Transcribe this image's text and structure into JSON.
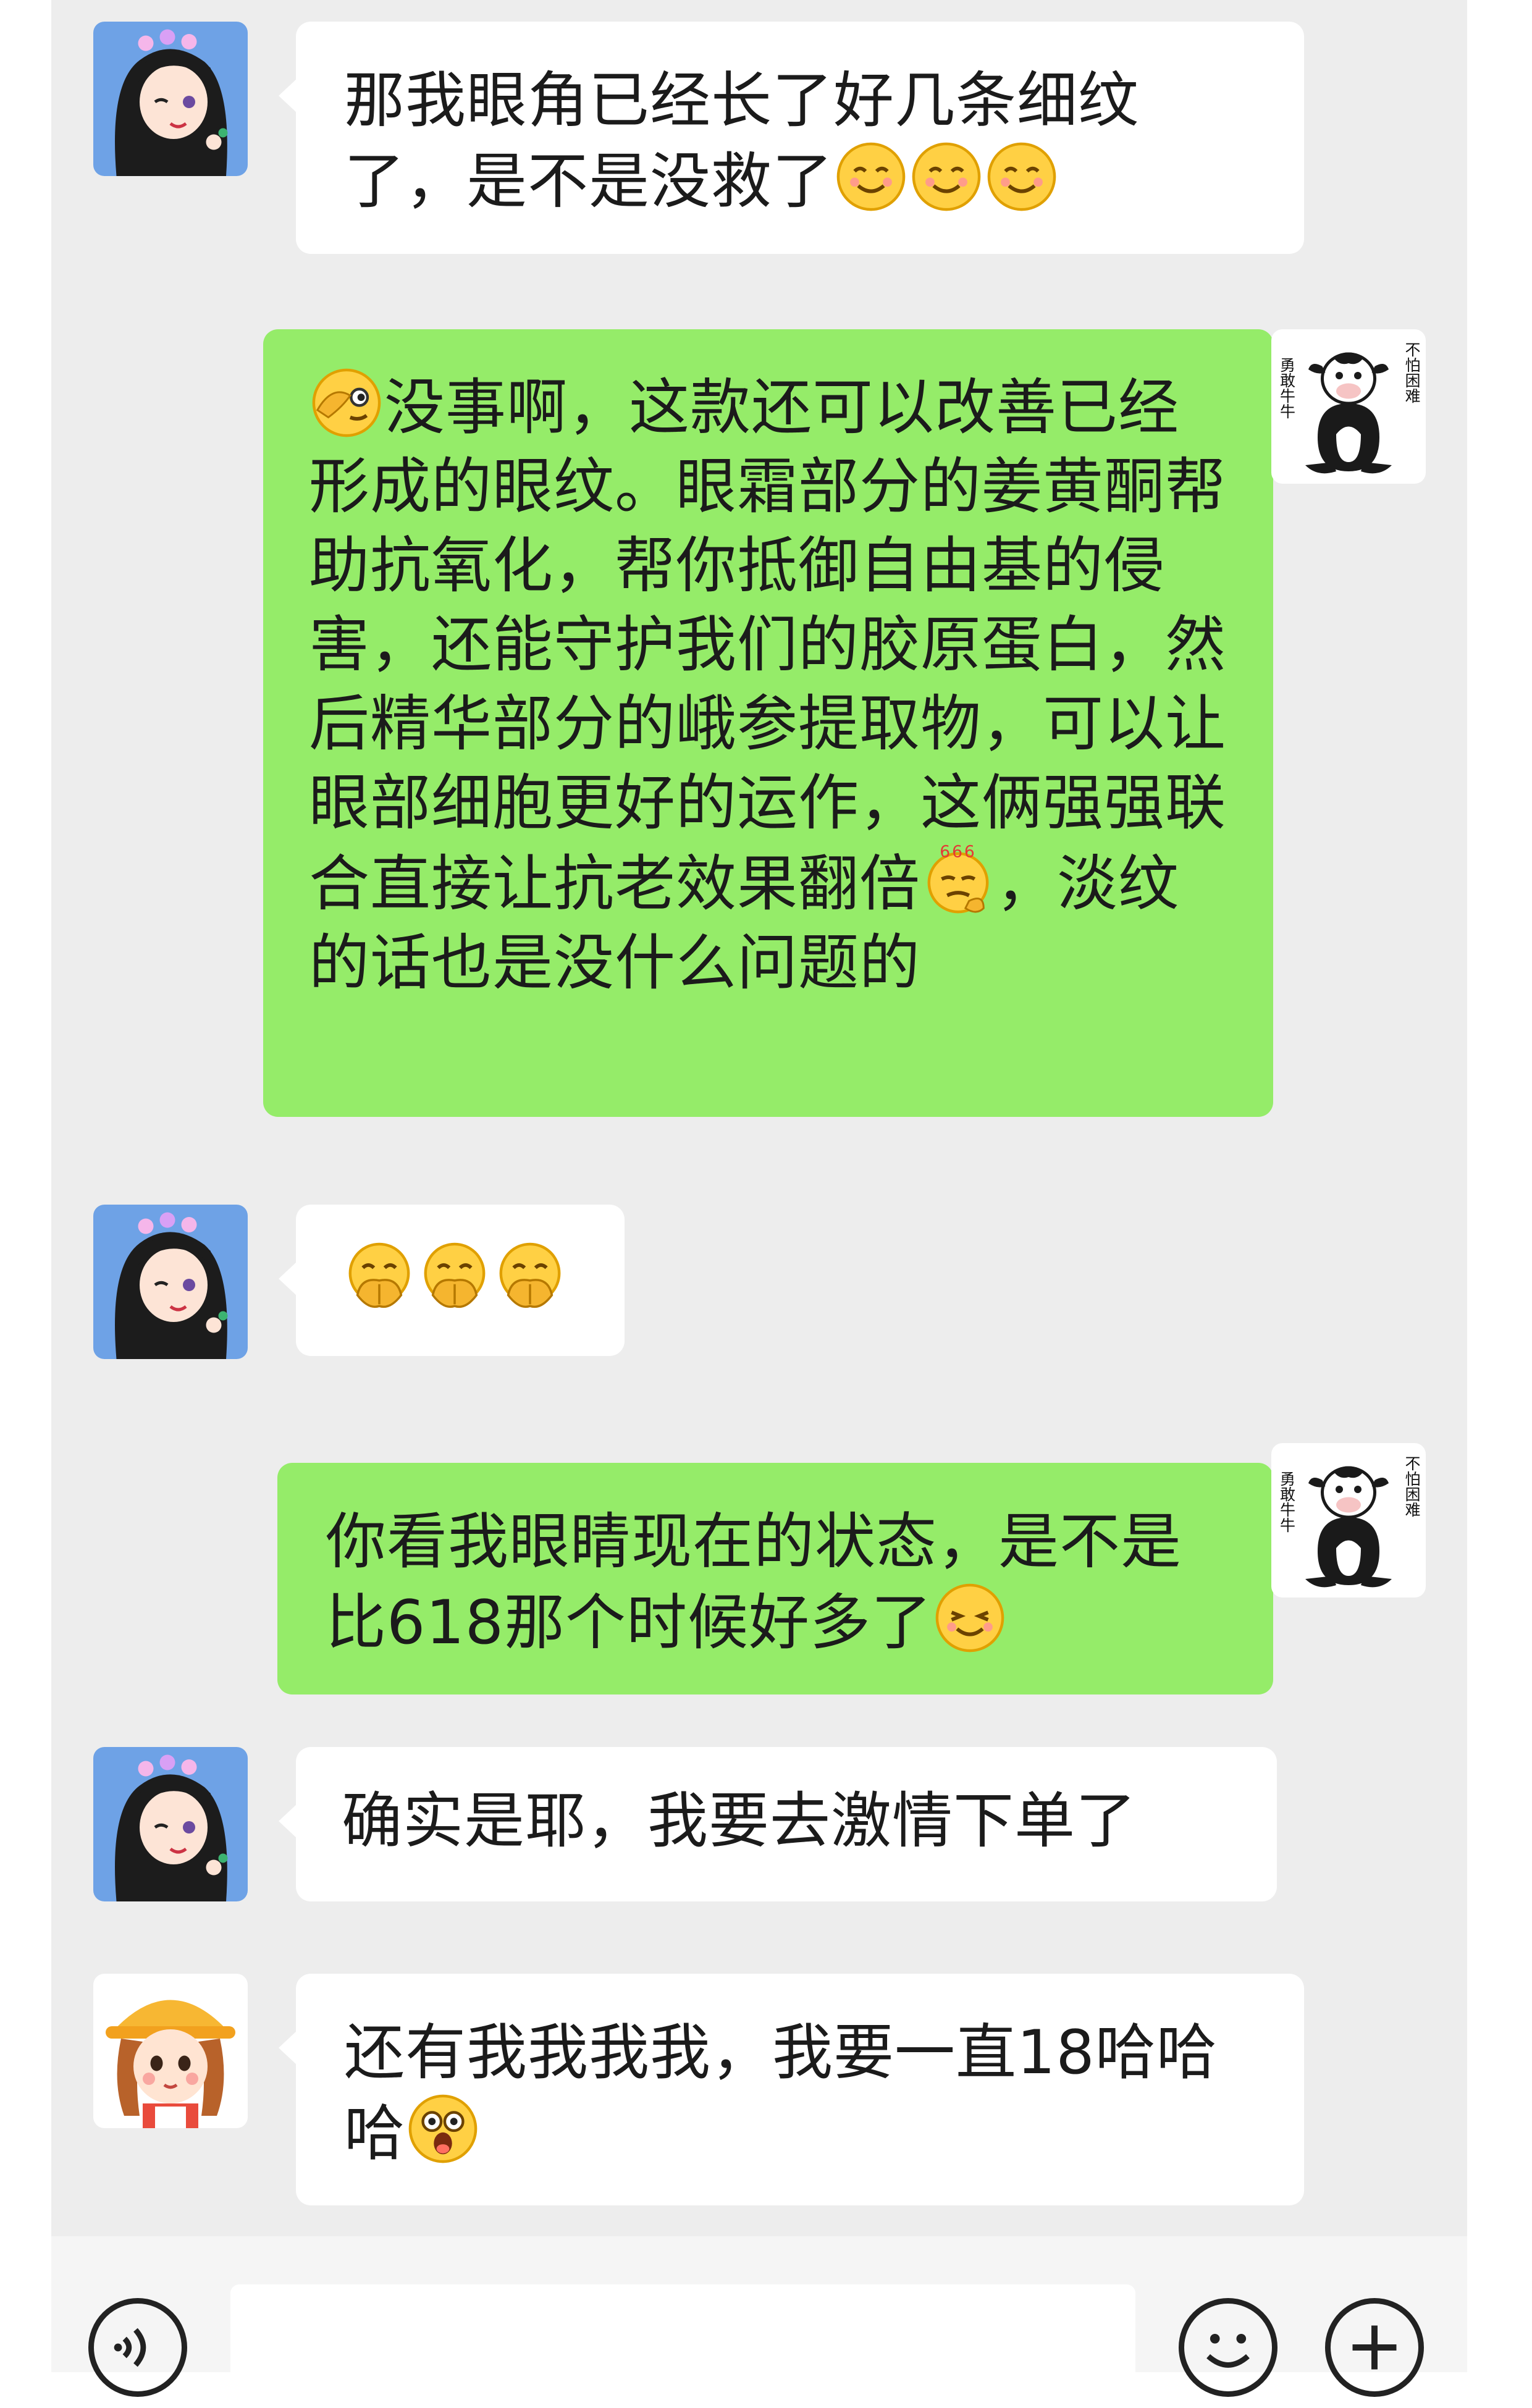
{
  "messages": [
    {
      "direction": "in",
      "sender": "girl",
      "text": "那我眼角已经长了好几条细纹了，是不是没救了",
      "emojis": [
        "smile-emoji",
        "smile-emoji",
        "smile-emoji"
      ]
    },
    {
      "direction": "out",
      "sender": "cow",
      "lead_emoji": "peek-emoji",
      "text_a": "没事啊，这款还可以改善已经形成的眼纹。眼霜部分的姜黄酮帮助抗氧化，帮你抵御自由基的侵害，还能守护我们的胶原蛋白，然后精华部分的峨参提取物，可以让眼部细胞更好的运作，这俩强强联合直接让抗老效果翻倍",
      "mid_emoji": "666-emoji",
      "text_b": "，淡纹的话也是没什么问题的"
    },
    {
      "direction": "in",
      "sender": "girl",
      "text": "",
      "emojis": [
        "fist-emoji",
        "fist-emoji",
        "fist-emoji"
      ]
    },
    {
      "direction": "out",
      "sender": "cow",
      "text": "你看我眼睛现在的状态，是不是比618那个时候好多了",
      "emojis": [
        "happy-emoji"
      ]
    },
    {
      "direction": "in",
      "sender": "girl",
      "text": "确实是耶，我要去激情下单了"
    },
    {
      "direction": "in",
      "sender": "girl2",
      "text": "还有我我我我，我要一直18哈哈哈",
      "emojis": [
        "shock-emoji"
      ]
    }
  ],
  "cow_avatar": {
    "left_text": "勇敢牛牛",
    "right_text": "不怕困难"
  },
  "colors": {
    "outgoing": "#95ec69",
    "incoming": "#ffffff",
    "background": "#ededed"
  },
  "input_bar": {
    "icons": [
      "voice-icon",
      "emoji-icon",
      "plus-icon"
    ]
  }
}
